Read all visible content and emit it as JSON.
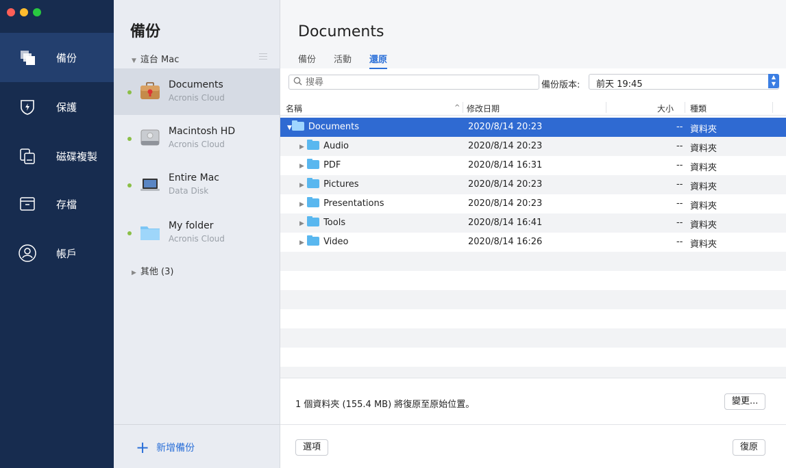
{
  "nav": {
    "items": [
      {
        "label": "備份",
        "icon": "backup-icon",
        "active": true
      },
      {
        "label": "保護",
        "icon": "shield-icon",
        "active": false
      },
      {
        "label": "磁碟複製",
        "icon": "disk-clone-icon",
        "active": false
      },
      {
        "label": "存檔",
        "icon": "archive-icon",
        "active": false
      },
      {
        "label": "帳戶",
        "icon": "account-icon",
        "active": false
      }
    ]
  },
  "sources": {
    "title": "備份",
    "group": "這台 Mac",
    "items": [
      {
        "name": "Documents",
        "sub": "Acronis Cloud",
        "icon": "briefcase-icon"
      },
      {
        "name": "Macintosh HD",
        "sub": "Acronis Cloud",
        "icon": "hard-drive-icon"
      },
      {
        "name": "Entire Mac",
        "sub": "Data Disk",
        "icon": "laptop-icon"
      },
      {
        "name": "My folder",
        "sub": "Acronis Cloud",
        "icon": "folder-icon"
      }
    ],
    "other": "其他 (3)",
    "add_label": "新增備份"
  },
  "main": {
    "title": "Documents",
    "tabs": [
      "備份",
      "活動",
      "還原"
    ],
    "active_tab": "還原",
    "search_placeholder": "搜尋",
    "version_label": "備份版本:",
    "version_value": "前天 19:45",
    "columns": {
      "name": "名稱",
      "date": "修改日期",
      "size": "大小",
      "kind": "種類"
    },
    "rows": [
      {
        "name": "Documents",
        "date": "2020/8/14 20:23",
        "size": "--",
        "kind": "資料夾",
        "expanded": true
      },
      {
        "name": "Audio",
        "date": "2020/8/14 20:23",
        "size": "--",
        "kind": "資料夾"
      },
      {
        "name": "PDF",
        "date": "2020/8/14 16:31",
        "size": "--",
        "kind": "資料夾"
      },
      {
        "name": "Pictures",
        "date": "2020/8/14 20:23",
        "size": "--",
        "kind": "資料夾"
      },
      {
        "name": "Presentations",
        "date": "2020/8/14 20:23",
        "size": "--",
        "kind": "資料夾"
      },
      {
        "name": "Tools",
        "date": "2020/8/14 16:41",
        "size": "--",
        "kind": "資料夾"
      },
      {
        "name": "Video",
        "date": "2020/8/14 16:26",
        "size": "--",
        "kind": "資料夾"
      }
    ],
    "status": "1 個資料夾 (155.4 MB) 將復原至原始位置。",
    "change_button": "變更...",
    "options_button": "選項",
    "restore_button": "復原"
  },
  "colors": {
    "accent": "#2a6fd8",
    "nav_bg": "#172c4f",
    "selection": "#2f6ad2"
  }
}
